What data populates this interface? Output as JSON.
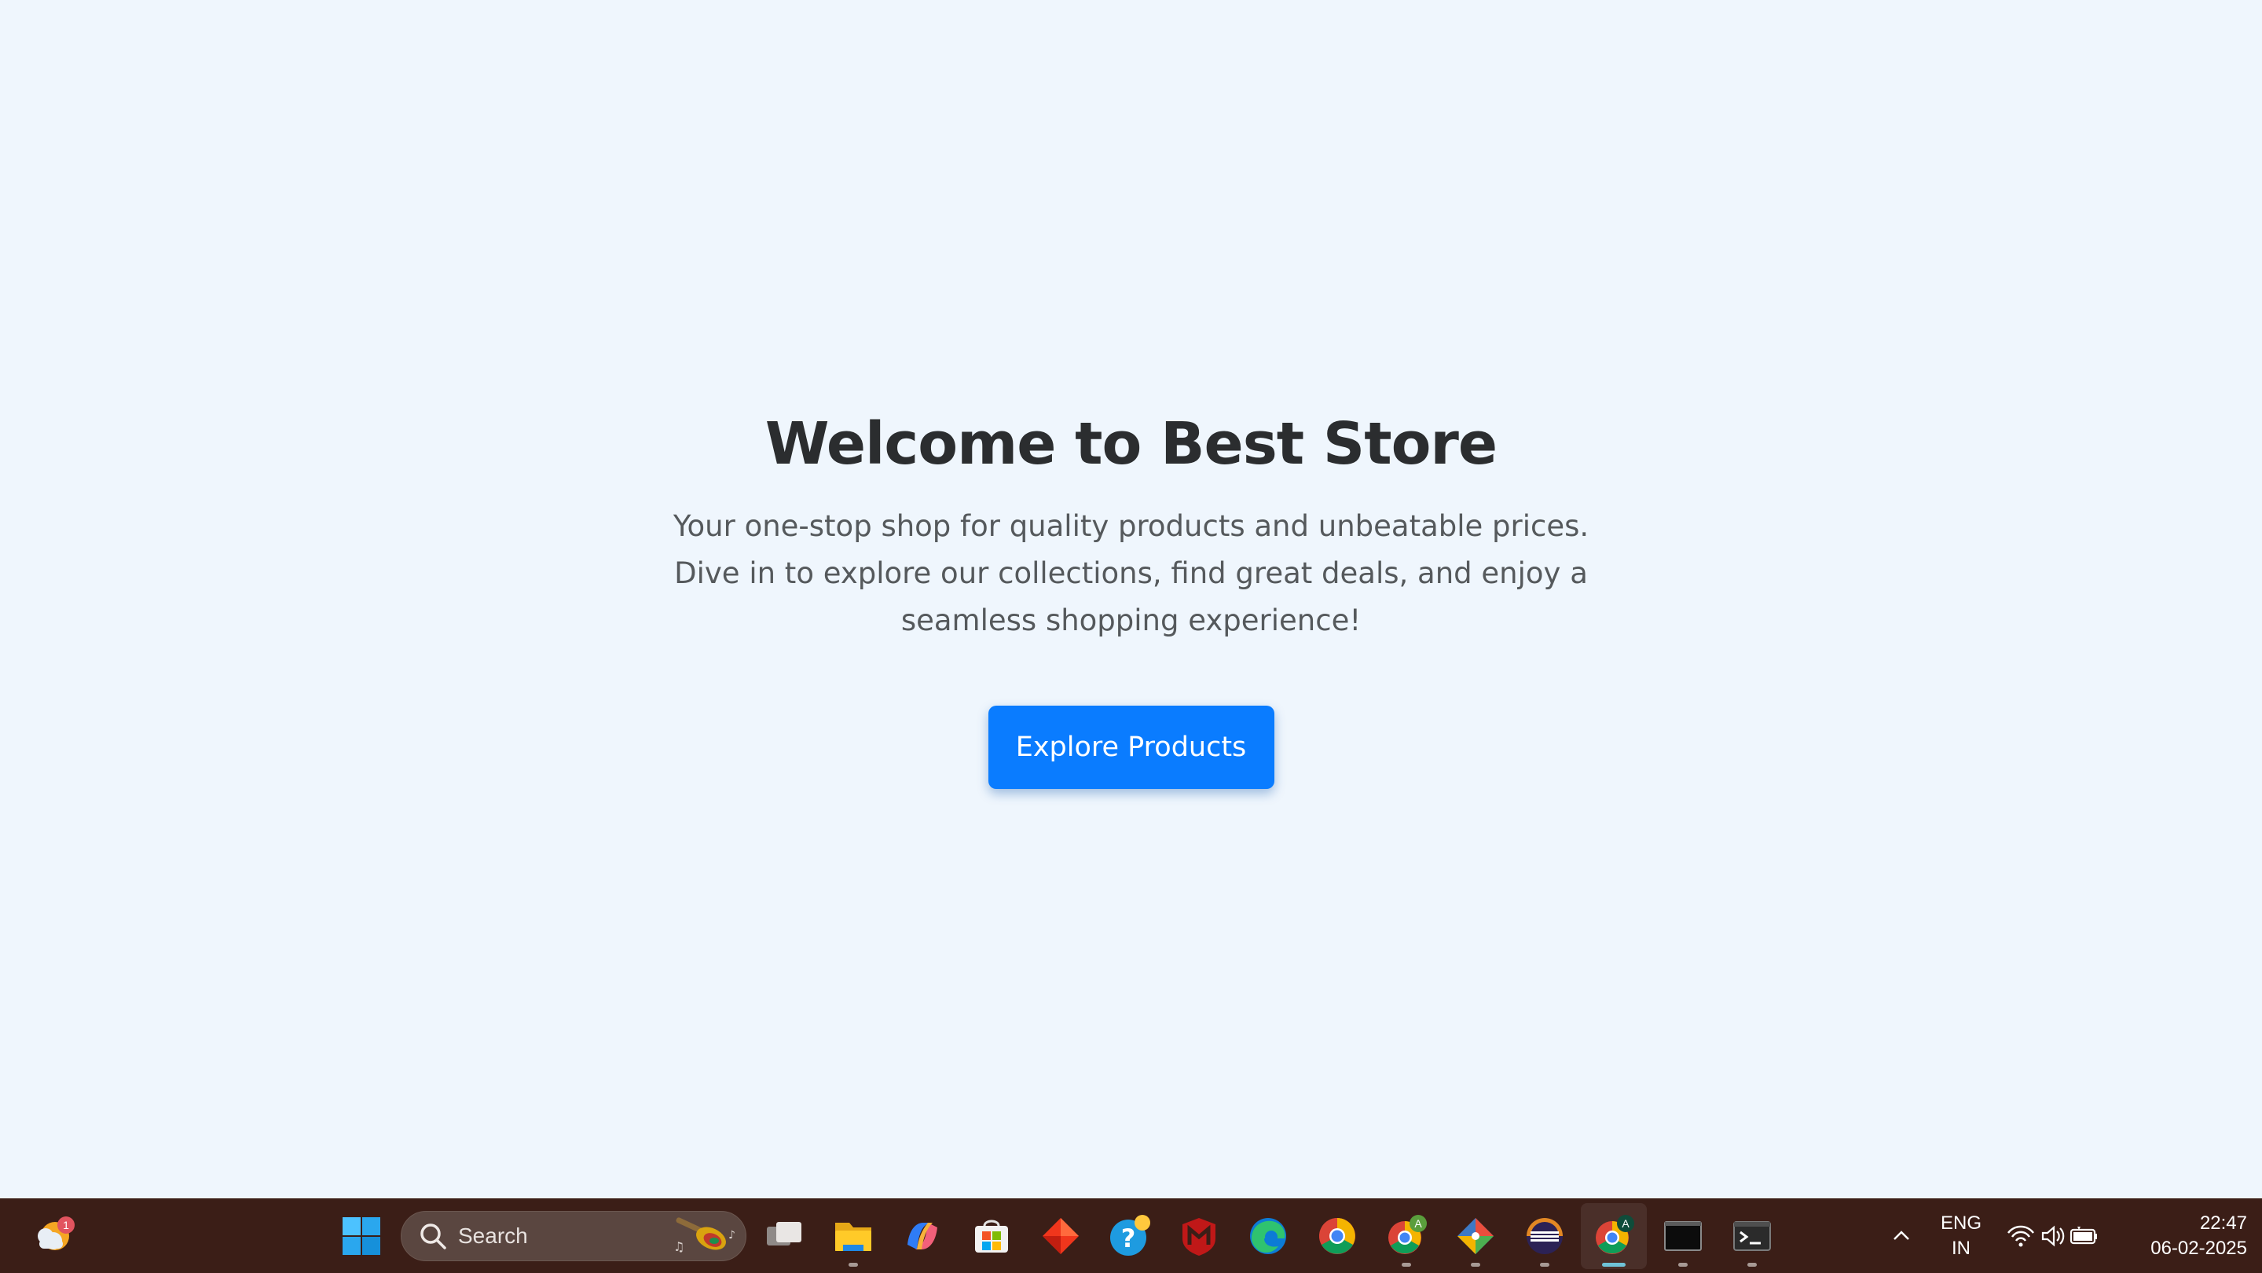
{
  "hero": {
    "title": "Welcome to Best Store",
    "line1": "Your one-stop shop for quality products and unbeatable prices.",
    "line2": "Dive in to explore our collections, find great deals, and enjoy a",
    "line3": "seamless shopping experience!",
    "cta_label": "Explore Products"
  },
  "colors": {
    "page_background": "#eff6fd",
    "title": "#2b2d2f",
    "body_text": "#55595c",
    "cta": "#0a7cff",
    "taskbar": "#3b1e17"
  },
  "taskbar": {
    "weather_badge": "1",
    "search_placeholder": "Search",
    "apps": [
      {
        "icon": "windows-start-icon",
        "running": false
      },
      {
        "icon": "task-view-icon",
        "running": false
      },
      {
        "icon": "file-explorer-icon",
        "running": true
      },
      {
        "icon": "copilot-icon",
        "running": false
      },
      {
        "icon": "microsoft-store-icon",
        "running": false
      },
      {
        "icon": "red-diamond-app-icon",
        "running": false
      },
      {
        "icon": "help-icon",
        "running": false
      },
      {
        "icon": "mcafee-icon",
        "running": false
      },
      {
        "icon": "edge-icon",
        "running": false
      },
      {
        "icon": "chrome-icon",
        "running": false
      },
      {
        "icon": "chrome-profile-icon",
        "running": true
      },
      {
        "icon": "git-icon",
        "running": true
      },
      {
        "icon": "eclipse-icon",
        "running": true
      },
      {
        "icon": "chrome-profile-active-icon",
        "running": true,
        "active": true
      },
      {
        "icon": "command-prompt-icon",
        "running": true
      },
      {
        "icon": "terminal-icon",
        "running": true
      }
    ],
    "profile_badge_a": "A",
    "tray": {
      "language": "ENG",
      "region": "IN",
      "time": "22:47",
      "date": "06-02-2025"
    }
  }
}
